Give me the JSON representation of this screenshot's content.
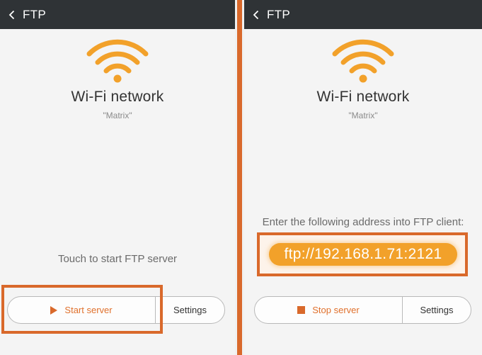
{
  "left": {
    "title": "FTP",
    "network_label": "Wi-Fi network",
    "ssid": "\"Matrix\"",
    "hint": "Touch to start FTP server",
    "primary_button": "Start server",
    "settings_button": "Settings"
  },
  "right": {
    "title": "FTP",
    "network_label": "Wi-Fi network",
    "ssid": "\"Matrix\"",
    "hint": "Enter the following address into FTP client:",
    "address": "ftp://192.168.1.71:2121",
    "primary_button": "Stop server",
    "settings_button": "Settings"
  },
  "colors": {
    "accent": "#e0712d",
    "highlight": "#d9692b",
    "address_pill": "#f2a12a",
    "titlebar": "#2f3336"
  },
  "icons": {
    "back": "chevron-left-icon",
    "wifi": "wifi-icon",
    "start": "play-icon",
    "stop": "stop-icon"
  }
}
